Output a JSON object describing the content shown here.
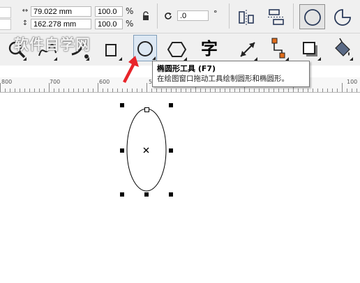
{
  "property_bar": {
    "width_value": "79.022 mm",
    "height_value": "162.278 mm",
    "scale_x": "100.0",
    "scale_y": "100.0",
    "percent_symbol": "%",
    "rotation_value": ".0",
    "degree_symbol": "°",
    "width_icon": "width-arrows-icon",
    "height_icon": "height-arrows-icon",
    "lock_icon": "lock-icon",
    "rotation_icon": "rotate-icon",
    "mirror_icon": "mirror-horizontal-icon",
    "mirror_v_icon": "mirror-vertical-icon",
    "ellipse_mode_icon": "ellipse-mode-icon",
    "pie_mode_icon": "pie-mode-icon"
  },
  "toolbox": {
    "tools": [
      {
        "name": "zoom-tool",
        "icon": "magnifier-icon"
      },
      {
        "name": "freehand-tool",
        "icon": "freehand-icon"
      },
      {
        "name": "artistic-media-tool",
        "icon": "brush-icon"
      },
      {
        "name": "rectangle-tool",
        "icon": "rectangle-icon"
      },
      {
        "name": "ellipse-tool",
        "icon": "ellipse-icon",
        "active": true
      },
      {
        "name": "polygon-tool",
        "icon": "hexagon-icon"
      },
      {
        "name": "text-tool",
        "icon": "text-icon",
        "label": "字"
      },
      {
        "name": "dimension-tool",
        "icon": "dimension-icon"
      },
      {
        "name": "connector-tool",
        "icon": "connector-icon"
      },
      {
        "name": "drop-shadow-tool",
        "icon": "shadow-icon"
      },
      {
        "name": "fill-tool",
        "icon": "fill-bucket-icon"
      }
    ]
  },
  "watermark": "软件自学网",
  "ruler": {
    "labels": [
      "800",
      "700",
      "600",
      "5",
      "100"
    ]
  },
  "tooltip": {
    "title": "椭圆形工具 (F7)",
    "description": "在绘图窗口拖动工具绘制圆形和椭圆形。"
  },
  "colors": {
    "ui_gray": "#f0f0f0",
    "pointer_arrow": "#e8242a",
    "active_tool_border": "#7f9db9",
    "connector_accent": "#e06c1a"
  }
}
